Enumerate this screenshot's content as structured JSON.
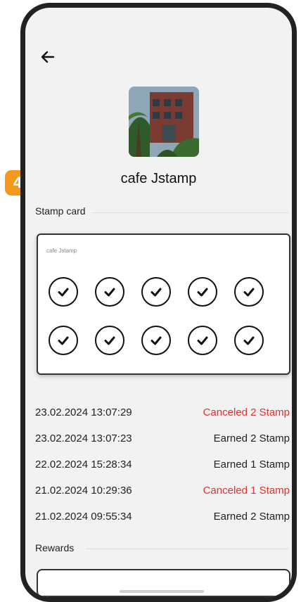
{
  "status_bar": {
    "time": "",
    "system": ""
  },
  "cafe": {
    "name": "cafe Jstamp"
  },
  "stamp_card": {
    "section_title": "Stamp card",
    "card_label": "cafe Jstamp",
    "total_stamps": 10,
    "stamped": 10
  },
  "history": [
    {
      "datetime": "23.02.2024 13:07:29",
      "action": "Canceled 2 Stamp",
      "type": "canceled"
    },
    {
      "datetime": "23.02.2024 13:07:23",
      "action": "Earned 2 Stamp",
      "type": "earned"
    },
    {
      "datetime": "22.02.2024 15:28:34",
      "action": "Earned 1 Stamp",
      "type": "earned"
    },
    {
      "datetime": "21.02.2024 10:29:36",
      "action": "Canceled 1 Stamp",
      "type": "canceled"
    },
    {
      "datetime": "21.02.2024 09:55:34",
      "action": "Earned 2 Stamp",
      "type": "earned"
    }
  ],
  "rewards": {
    "section_title": "Rewards"
  },
  "step_badge": "4",
  "colors": {
    "canceled": "#e0322c",
    "badge": "#f39a1e",
    "frame": "#222222"
  }
}
